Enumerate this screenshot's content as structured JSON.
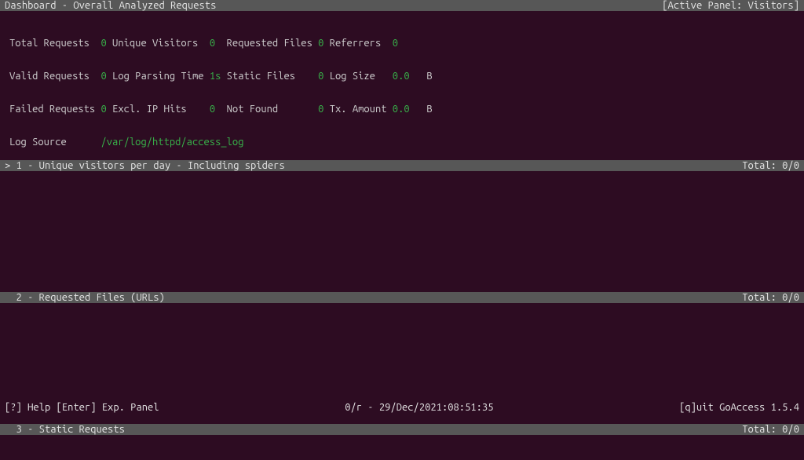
{
  "header": {
    "title": "Dashboard - Overall Analyzed Requests",
    "active_panel": "[Active Panel: Visitors]"
  },
  "stats": {
    "r1": {
      "l1": "Total Requests  ",
      "v1": "0",
      "l2": " Unique Visitors  ",
      "v2": "0 ",
      "l3": " Requested Files ",
      "v3": "0",
      "l4": " Referrers  ",
      "v4": "0"
    },
    "r2": {
      "l1": "Valid Requests  ",
      "v1": "0",
      "l2": " Log Parsing Time ",
      "v2": "1s",
      "l3": " Static Files    ",
      "v3": "0",
      "l4": " Log Size   ",
      "v4": "0.0",
      "u4": "   B"
    },
    "r3": {
      "l1": "Failed Requests ",
      "v1": "0",
      "l2": " Excl. IP Hits    ",
      "v2": "0 ",
      "l3": " Not Found       ",
      "v3": "0",
      "l4": " Tx. Amount ",
      "v4": "0.0",
      "u4": "   B"
    },
    "r4": {
      "l1": "Log Source      ",
      "v1": "/var/log/httpd/access_log"
    }
  },
  "panels": [
    {
      "title": "> 1 - Unique visitors per day - Including spiders",
      "total": "Total: 0/0"
    },
    {
      "title": "  2 - Requested Files (URLs)",
      "total": "Total: 0/0"
    },
    {
      "title": "  3 - Static Requests",
      "total": "Total: 0/0"
    }
  ],
  "footer": {
    "left": "[?] Help [Enter] Exp. Panel",
    "center": "0/r - 29/Dec/2021:08:51:35",
    "right": "[q]uit GoAccess 1.5.4"
  }
}
